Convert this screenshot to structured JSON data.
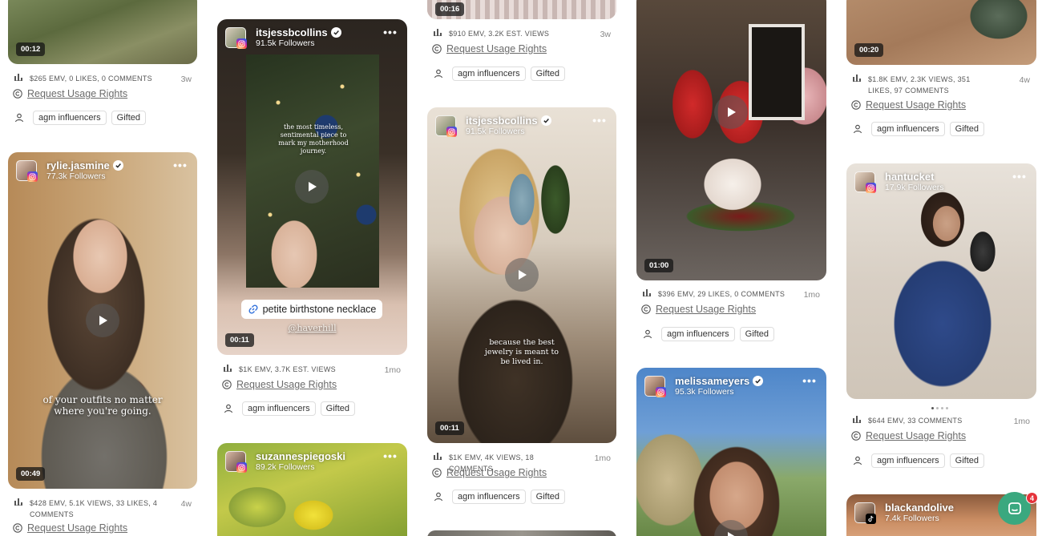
{
  "ui": {
    "request_label": "Request Usage Rights",
    "more_label": "•••",
    "play_label": "play"
  },
  "colors": {
    "accent_chat": "#3aa87f",
    "badge": "#e5333b",
    "link": "#6b6b6b"
  },
  "icons": {
    "stats": "bar-chart-icon",
    "rights": "copyright-icon",
    "tags": "person-icon",
    "more": "more-horizontal-icon",
    "network_instagram": "instagram-icon",
    "network_tiktok": "tiktok-icon",
    "chat": "chat-icon"
  },
  "chat": {
    "badge_count": "4"
  },
  "cards": {
    "c1": {
      "duration": "00:12",
      "stats": "$265 EMV, 0 LIKES, 0 COMMENTS",
      "age": "3w",
      "tags": [
        "agm influencers",
        "Gifted"
      ]
    },
    "c2": {
      "username": "rylie.jasmine",
      "followers": "77.3k Followers",
      "duration": "00:49",
      "overlay": "of your outfits no matter where you're going.",
      "stats": "$428 EMV, 5.1K VIEWS, 33 LIKES, 4 COMMENTS",
      "age": "4w"
    },
    "c3": {
      "username": "itsjessbcollins",
      "followers": "91.5k Followers",
      "duration": "00:11",
      "overlay": "the most timeless, sentimental piece to mark my motherhood journey.",
      "link_text": "petite birthstone necklace",
      "handle": "@haverhill",
      "stats": "$1K EMV, 3.7K EST. VIEWS",
      "age": "1mo",
      "tags": [
        "agm influencers",
        "Gifted"
      ]
    },
    "c4": {
      "username": "suzannespiegoski",
      "followers": "89.2k Followers"
    },
    "c5": {
      "duration": "00:16",
      "stats": "$910 EMV, 3.2K EST. VIEWS",
      "age": "3w",
      "tags": [
        "agm influencers",
        "Gifted"
      ]
    },
    "c6": {
      "username": "itsjessbcollins",
      "followers": "91.5k Followers",
      "duration": "00:11",
      "overlay": "because the best jewelry is meant to be lived in.",
      "stats": "$1K EMV, 4K VIEWS, 18 COMMENTS",
      "age": "1mo",
      "tags": [
        "agm influencers",
        "Gifted"
      ]
    },
    "c7": {
      "duration": "01:00",
      "stats": "$396 EMV, 29 LIKES, 0 COMMENTS",
      "age": "1mo",
      "tags": [
        "agm influencers",
        "Gifted"
      ]
    },
    "c8": {
      "username": "melissameyers",
      "followers": "95.3k Followers"
    },
    "c9": {
      "duration": "00:20",
      "stats": "$1.8K EMV, 2.3K VIEWS, 351 LIKES, 97 COMMENTS",
      "age": "4w",
      "tags": [
        "agm influencers",
        "Gifted"
      ]
    },
    "c10": {
      "username": "hantucket",
      "followers": "17.9k Followers",
      "stats": "$644 EMV, 33 COMMENTS",
      "age": "1mo",
      "tags": [
        "agm influencers",
        "Gifted"
      ]
    },
    "c11": {
      "username": "blackandolive",
      "followers": "7.4k Followers"
    }
  }
}
